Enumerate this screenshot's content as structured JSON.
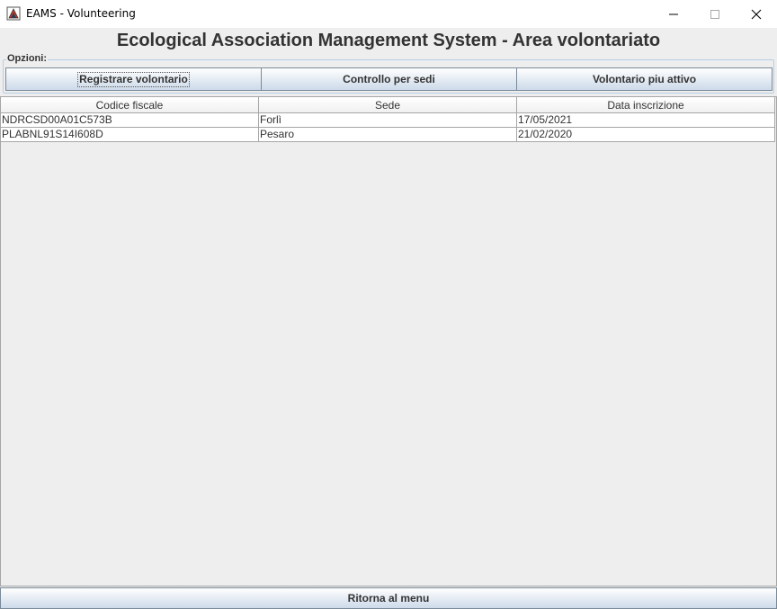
{
  "window": {
    "title": "EAMS - Volunteering",
    "icon": "java-app-icon",
    "controls": [
      "minimize-icon",
      "maximize-icon",
      "close-icon"
    ]
  },
  "header": {
    "title": "Ecological Association Management System - Area volontariato"
  },
  "options": {
    "legend": "Opzioni:",
    "buttons": [
      {
        "label": "Registrare volontario"
      },
      {
        "label": "Controllo per sedi"
      },
      {
        "label": "Volontario piu attivo"
      }
    ]
  },
  "table": {
    "columns": [
      "Codice fiscale",
      "Sede",
      "Data inscrizione"
    ],
    "rows": [
      [
        "NDRCSD00A01C573B",
        "Forlì",
        "17/05/2021"
      ],
      [
        "PLABNL91S14I608D",
        "Pesaro",
        "21/02/2020"
      ]
    ]
  },
  "footer": {
    "back_label": "Ritorna al menu"
  },
  "colors": {
    "window_bg": "#eeeeee",
    "titlebar_bg": "#ffffff",
    "button_gradient_bottom": "#cddaea",
    "border": "#7a8a99"
  }
}
